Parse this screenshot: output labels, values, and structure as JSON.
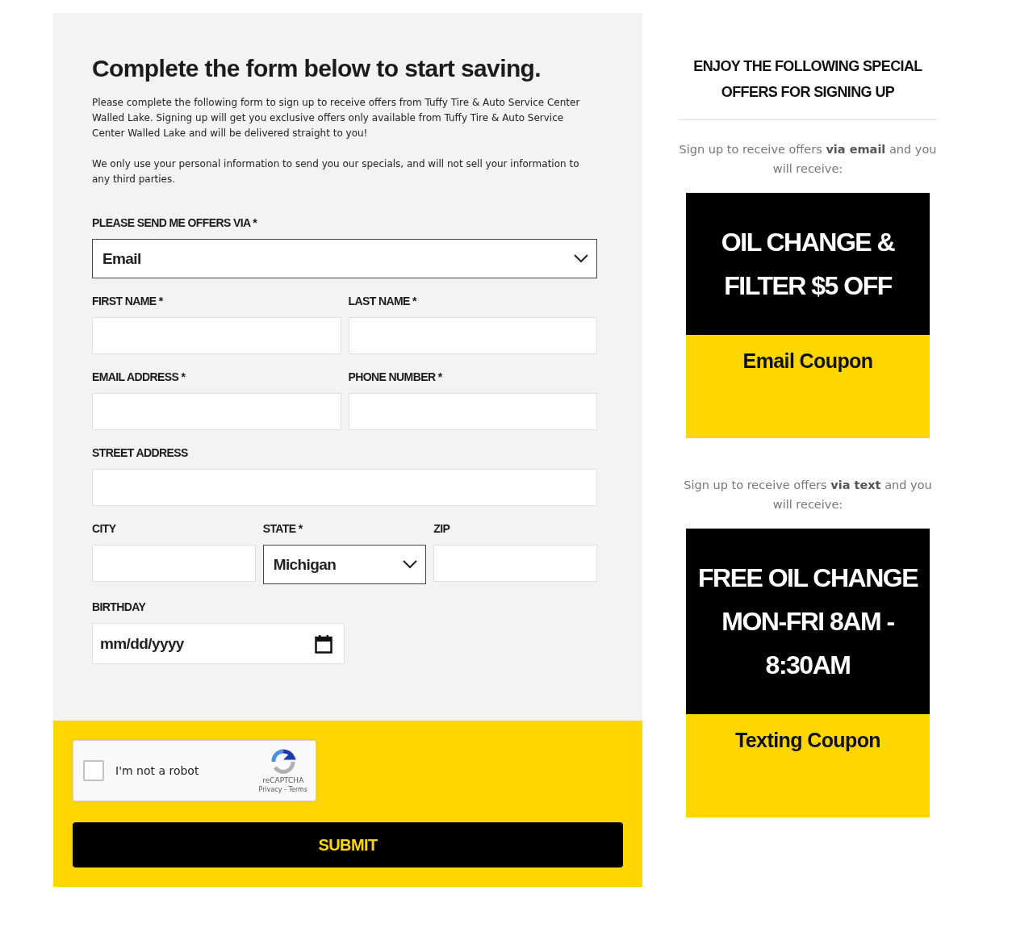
{
  "form": {
    "heading": "Complete the form below to start saving.",
    "paragraphs": [
      "Please complete the following form to sign up to receive offers from Tuffy Tire & Auto Service Center Walled Lake. Signing up will get you exclusive offers only available from Tuffy Tire & Auto Service Center Walled Lake and will be delivered straight to you!",
      "We only use your personal information to send you our specials, and will not sell your information to any third parties."
    ],
    "rows": [
      [
        {
          "label": "PLEASE SEND ME OFFERS VIA *",
          "kind": "select",
          "value": "Email"
        }
      ],
      [
        {
          "label": "FIRST NAME *",
          "kind": "text"
        },
        {
          "label": "LAST NAME *",
          "kind": "text"
        }
      ],
      [
        {
          "label": "EMAIL ADDRESS *",
          "kind": "text"
        },
        {
          "label": "PHONE NUMBER *",
          "kind": "text"
        }
      ],
      [
        {
          "label": "STREET ADDRESS",
          "kind": "text"
        }
      ],
      [
        {
          "label": "CITY",
          "kind": "text"
        },
        {
          "label": "STATE *",
          "kind": "select",
          "value": "Michigan"
        },
        {
          "label": "ZIP",
          "kind": "text"
        }
      ],
      [
        {
          "label": "BIRTHDAY",
          "kind": "date",
          "placeholder": "mm/dd/yyyy"
        }
      ]
    ],
    "captcha": {
      "checked": false,
      "label": "I'm not a robot",
      "brand": "reCAPTCHA",
      "links": "Privacy - Terms"
    },
    "submit": "SUBMIT"
  },
  "offers": {
    "heading": "ENJOY THE FOLLOWING SPECIAL OFFERS FOR SIGNING UP",
    "items": [
      {
        "intro": "Sign up to receive offers **via email** and you will receive:",
        "title": "OIL CHANGE & FILTER $5 OFF",
        "label": "Email Coupon"
      },
      {
        "intro": "Sign up to receive offers **via text** and you will receive:",
        "title": "FREE OIL CHANGE MON-FRI 8AM - 8:30AM",
        "label": "Texting Coupon"
      }
    ]
  }
}
